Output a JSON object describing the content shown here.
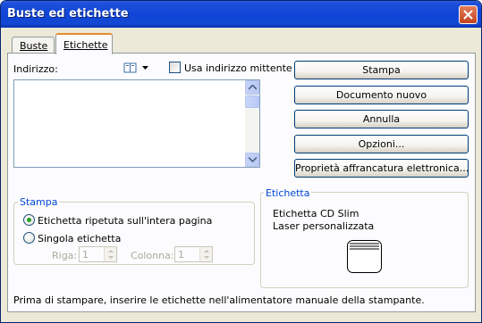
{
  "window": {
    "title": "Buste ed etichette"
  },
  "tabs": [
    {
      "label": "Buste",
      "selected": false
    },
    {
      "label": "Etichette",
      "selected": true
    }
  ],
  "address": {
    "label": "Indirizzo:",
    "value": "",
    "icon": "address-book-icon",
    "use_sender_label": "Usa indirizzo mittente",
    "use_sender_checked": false
  },
  "buttons": {
    "print": "Stampa",
    "new_document": "Documento nuovo",
    "cancel": "Annulla",
    "options": "Opzioni...",
    "epostage": "Proprietà affrancatura elettronica..."
  },
  "print_group": {
    "title": "Stampa",
    "full_page_label": "Etichetta ripetuta sull'intera pagina",
    "full_page_selected": true,
    "single_label": "Singola etichetta",
    "single_selected": false,
    "row_label": "Riga:",
    "row_value": "1",
    "column_label": "Colonna:",
    "column_value": "1"
  },
  "label_group": {
    "title": "Etichetta",
    "line1": "Etichetta CD Slim",
    "line2": "Laser personalizzata",
    "icon": "label-sheet-icon"
  },
  "status": "Prima di stampare, inserire le etichette nell'alimentatore manuale della stampante.",
  "colors": {
    "titlebar": "#0f45d6",
    "dialog_bg": "#ece9d8",
    "group_title": "#0046d5",
    "radio_dot": "#21a121",
    "tab_highlight": "#e68b2c"
  }
}
